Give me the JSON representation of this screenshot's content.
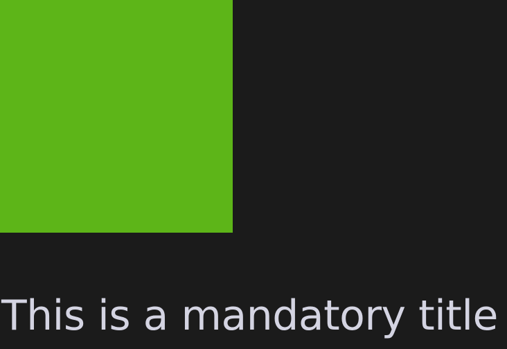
{
  "colors": {
    "background": "#1b1b1b",
    "swatch": "#5db518",
    "title_text": "#d4d4e2"
  },
  "title": "This is a mandatory title"
}
